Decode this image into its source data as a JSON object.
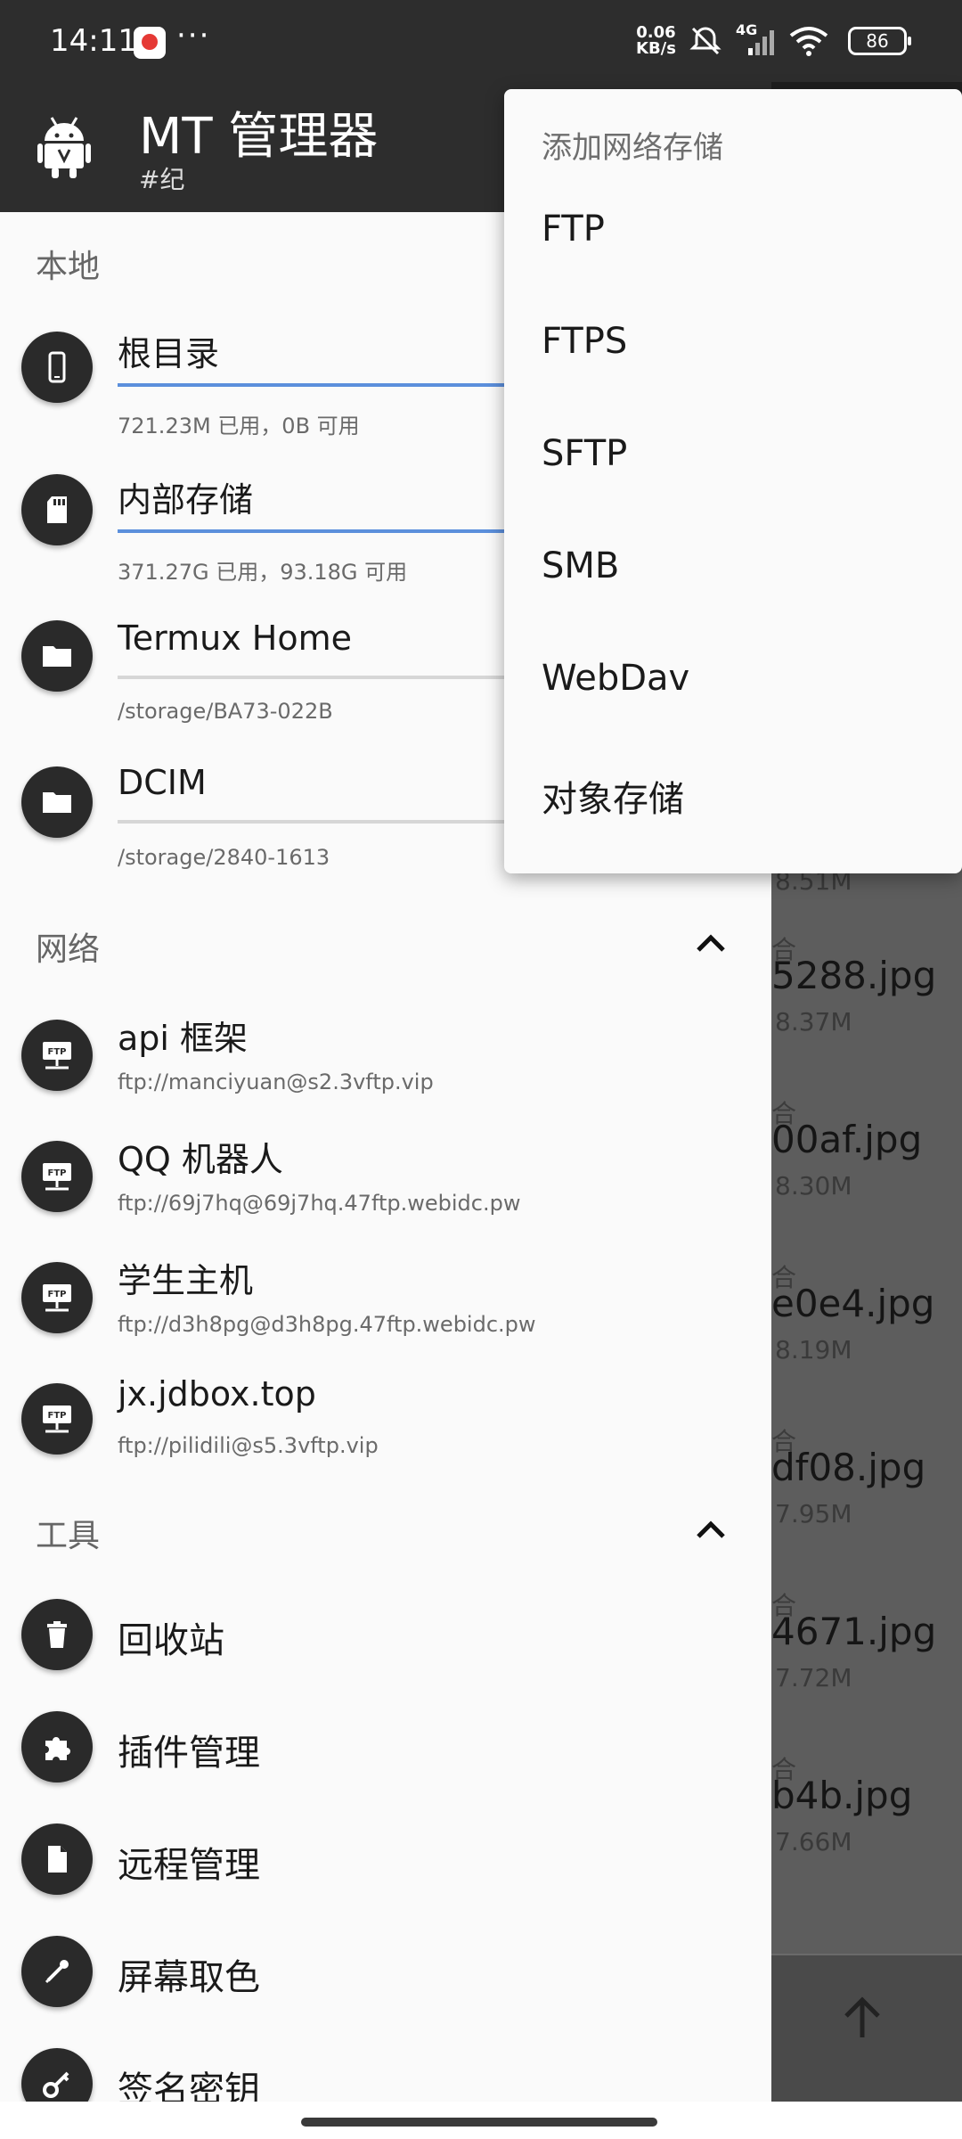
{
  "status_bar": {
    "time": "14:11",
    "more": "···",
    "speed_value": "0.06",
    "speed_unit": "KB/s",
    "network": "4G",
    "battery": "86"
  },
  "background_files": [
    {
      "frag": "",
      "name": "",
      "size": "8.51M"
    },
    {
      "frag": "合",
      "name": "5288.jpg",
      "size": "8.37M"
    },
    {
      "frag": "合",
      "name": "00af.jpg",
      "size": "8.30M"
    },
    {
      "frag": "合",
      "name": "e0e4.jpg",
      "size": "8.19M"
    },
    {
      "frag": "合",
      "name": "df08.jpg",
      "size": "7.95M"
    },
    {
      "frag": "合",
      "name": "4671.jpg",
      "size": "7.72M"
    },
    {
      "frag": "合",
      "name": "b4b.jpg",
      "size": "7.66M"
    }
  ],
  "drawer": {
    "app_title": "MT 管理器",
    "app_subtitle": "#纪",
    "sections": {
      "local": "本地",
      "network": "网络",
      "tools": "工具"
    },
    "local_items": [
      {
        "title": "根目录",
        "sub": "721.23M 已用，0B 可用",
        "usage": 1.0,
        "icon": "phone-icon"
      },
      {
        "title": "内部存储",
        "sub": "371.27G 已用，93.18G 可用",
        "usage": 0.8,
        "icon": "sd-card-icon"
      },
      {
        "title": "Termux Home",
        "sub": "/storage/BA73-022B",
        "usage": 0,
        "icon": "folder-icon"
      },
      {
        "title": "DCIM",
        "sub": "/storage/2840-1613",
        "usage": 0,
        "icon": "folder-icon"
      }
    ],
    "network_items": [
      {
        "title": "api 框架",
        "sub": "ftp://manciyuan@s2.3vftp.vip"
      },
      {
        "title": "QQ 机器人",
        "sub": "ftp://69j7hq@69j7hq.47ftp.webidc.pw"
      },
      {
        "title": "学生主机",
        "sub": "ftp://d3h8pg@d3h8pg.47ftp.webidc.pw"
      },
      {
        "title": "jx.jdbox.top",
        "sub": "ftp://pilidili@s5.3vftp.vip"
      }
    ],
    "ftp_icon_label": "FTP",
    "tool_items": [
      {
        "title": "回收站",
        "icon": "trash-icon"
      },
      {
        "title": "插件管理",
        "icon": "puzzle-icon"
      },
      {
        "title": "远程管理",
        "icon": "file-icon"
      },
      {
        "title": "屏幕取色",
        "icon": "eyedropper-icon"
      },
      {
        "title": "签名密钥",
        "icon": "key-icon"
      }
    ]
  },
  "popup_menu": {
    "title": "添加网络存储",
    "items": [
      "FTP",
      "FTPS",
      "SFTP",
      "SMB",
      "WebDav",
      "对象存储"
    ]
  },
  "colors": {
    "dark_bar": "#2d2d2d",
    "accent_blue": "#5b8fdc",
    "drawer_bg": "#fafafa"
  }
}
